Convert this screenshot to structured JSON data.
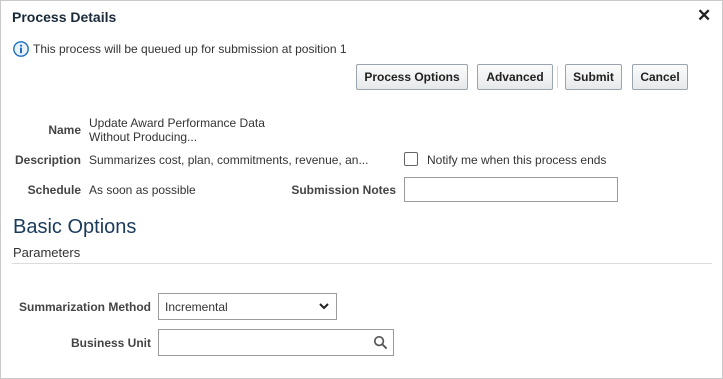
{
  "dialog": {
    "title": "Process Details",
    "close_glyph": "✕"
  },
  "info": {
    "icon": "info-icon",
    "message": "This process will be queued up for submission at position 1"
  },
  "toolbar": {
    "process_options_label": "Process Options",
    "advanced_label": "Advanced",
    "submit_label": "Submit",
    "cancel_label": "Cancel"
  },
  "details": {
    "name_label": "Name",
    "name_line1": "Update Award Performance Data",
    "name_line2": "Without Producing...",
    "description_label": "Description",
    "description_value": "Summarizes cost, plan, commitments, revenue, an...",
    "schedule_label": "Schedule",
    "schedule_value": "As soon as possible",
    "notify_label": "Notify me when this process ends",
    "notify_checked": false,
    "submission_notes_label": "Submission Notes",
    "submission_notes_value": ""
  },
  "basic_options": {
    "heading": "Basic Options",
    "parameters_heading": "Parameters",
    "summarization_method_label": "Summarization Method",
    "summarization_method_value": "Incremental",
    "business_unit_label": "Business Unit",
    "business_unit_value": ""
  },
  "colors": {
    "accent_heading": "#1a3a5c",
    "info_blue": "#1e6fc2",
    "border": "#9b9b9b"
  }
}
